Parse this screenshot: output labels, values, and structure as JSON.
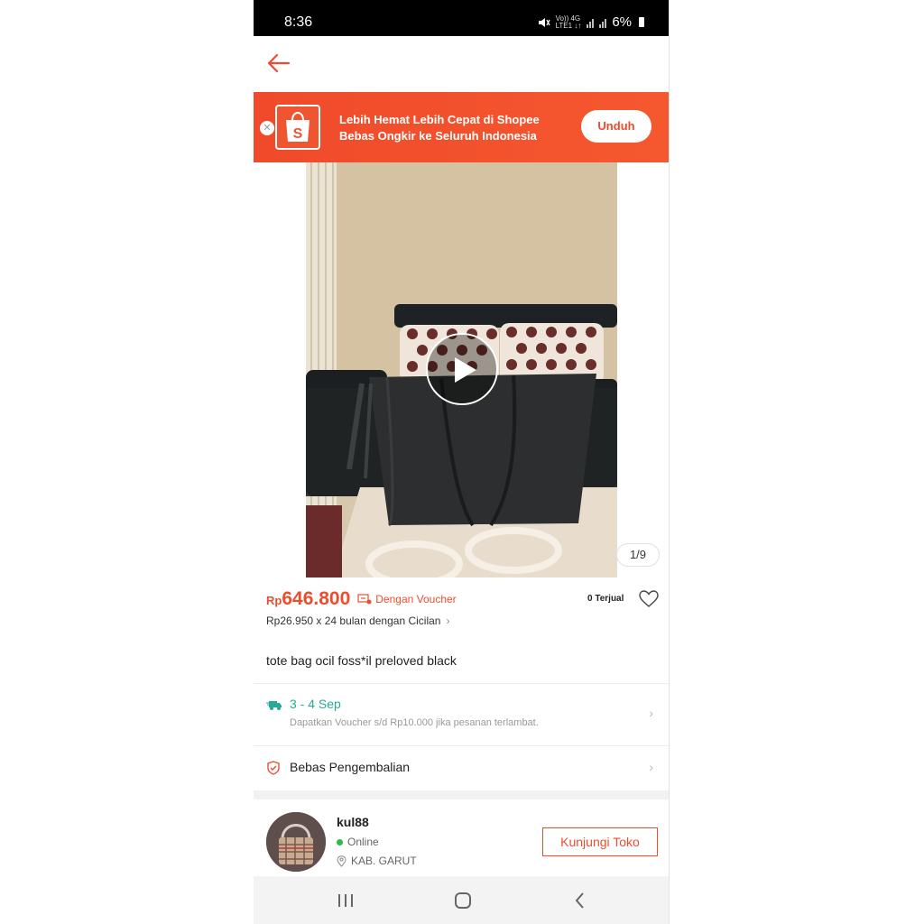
{
  "status_bar": {
    "time": "8:36",
    "network_top": "Vo)) 4G",
    "network_bottom": "LTE1 ↓↑",
    "battery": "6%"
  },
  "header": {
    "back_icon": "arrow-left-icon"
  },
  "banner": {
    "line1": "Lebih Hemat Lebih Cepat di Shopee",
    "line2": "Bebas Ongkir ke Seluruh Indonesia",
    "button": "Unduh",
    "close_icon": "close-icon",
    "logo_letter": "S"
  },
  "gallery": {
    "counter": "1/9",
    "play_icon": "play-icon"
  },
  "price": {
    "currency": "Rp",
    "value": "646.800",
    "voucher_label": "Dengan Voucher",
    "sold": "0 Terjual",
    "installment": "Rp26.950 x 24 bulan dengan Cicilan"
  },
  "product": {
    "title": "tote bag ocil foss*il preloved black"
  },
  "shipping": {
    "date": "3 - 4 Sep",
    "note": "Dapatkan Voucher s/d Rp10.000 jika pesanan terlambat."
  },
  "returns": {
    "label": "Bebas Pengembalian"
  },
  "shop": {
    "name": "kul88",
    "status": "Online",
    "location": "KAB. GARUT",
    "visit_button": "Kunjungi Toko"
  },
  "colors": {
    "accent": "#ee4d2d",
    "shipping": "#26aa99",
    "online": "#30b94a"
  }
}
